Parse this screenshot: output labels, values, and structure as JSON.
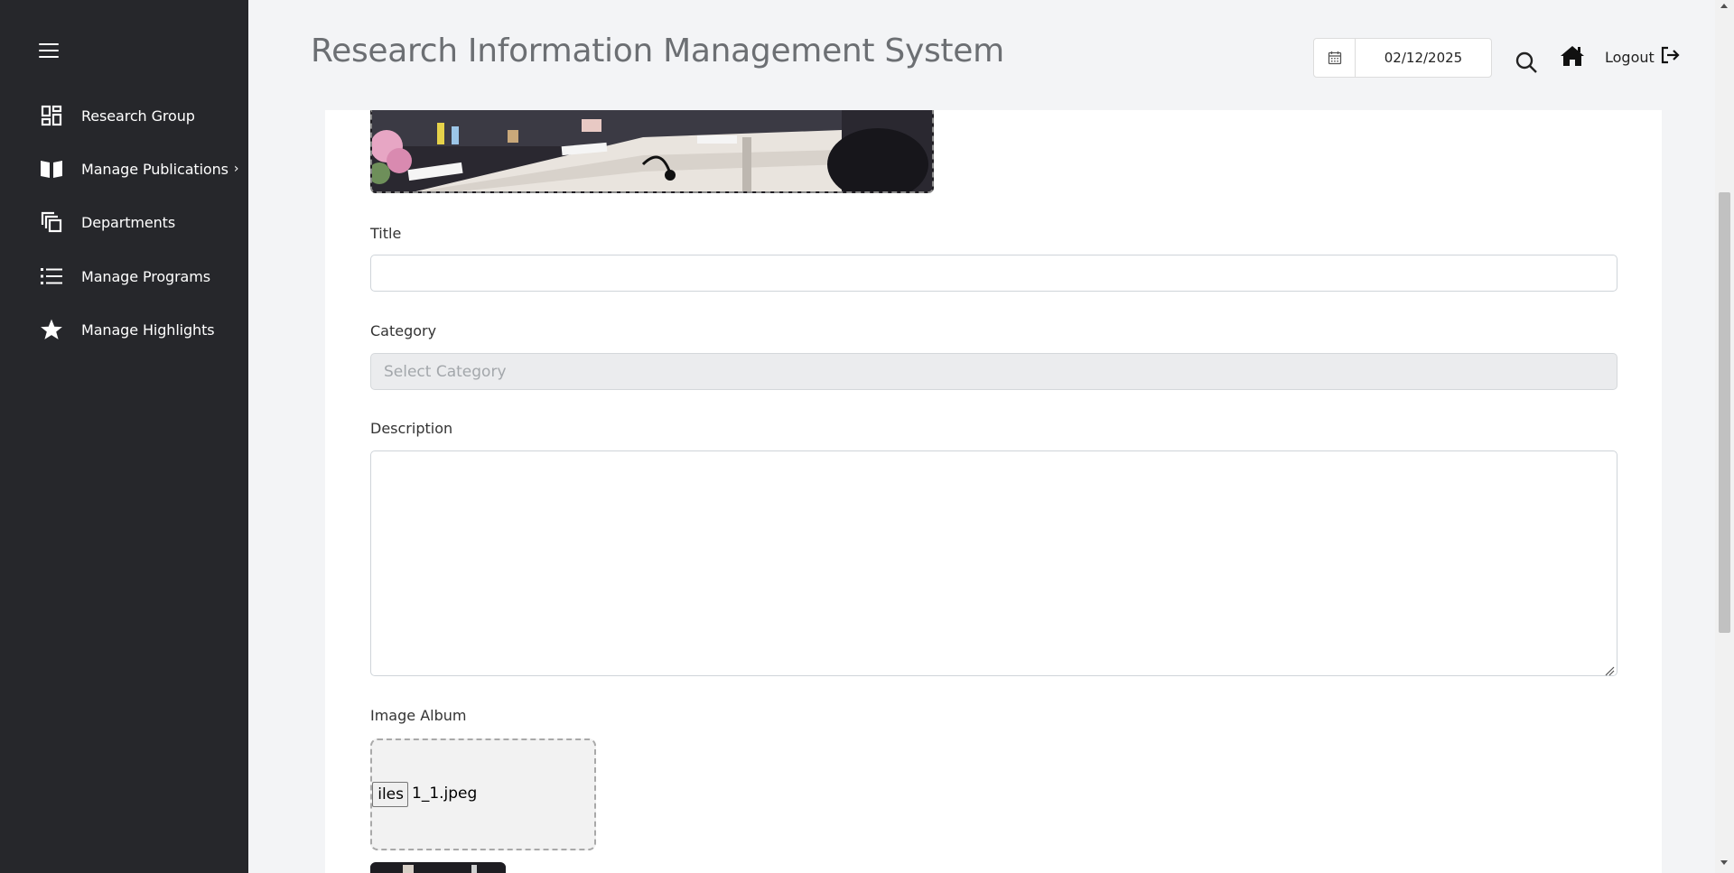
{
  "header": {
    "title": "Research Information Management System",
    "date_value": "02/12/2025",
    "logout_label": "Logout"
  },
  "sidebar": {
    "items": [
      {
        "label": "Research Group",
        "icon": "dashboard-icon"
      },
      {
        "label": "Manage Publications",
        "icon": "book-icon",
        "chevron": "›"
      },
      {
        "label": "Departments",
        "icon": "copy-icon"
      },
      {
        "label": "Manage Programs",
        "icon": "list-icon"
      },
      {
        "label": "Manage Highlights",
        "icon": "star-icon"
      }
    ]
  },
  "form": {
    "title_label": "Title",
    "title_value": "",
    "category_label": "Category",
    "category_placeholder": "Select Category",
    "description_label": "Description",
    "description_value": "",
    "image_album_label": "Image Album",
    "file_button_label": "iles",
    "file_name": "1_1.jpeg"
  },
  "colors": {
    "sidebar_bg": "#26272b",
    "page_bg": "#f3f4f6",
    "card_bg": "#ffffff",
    "select_bg": "#ebecee"
  }
}
